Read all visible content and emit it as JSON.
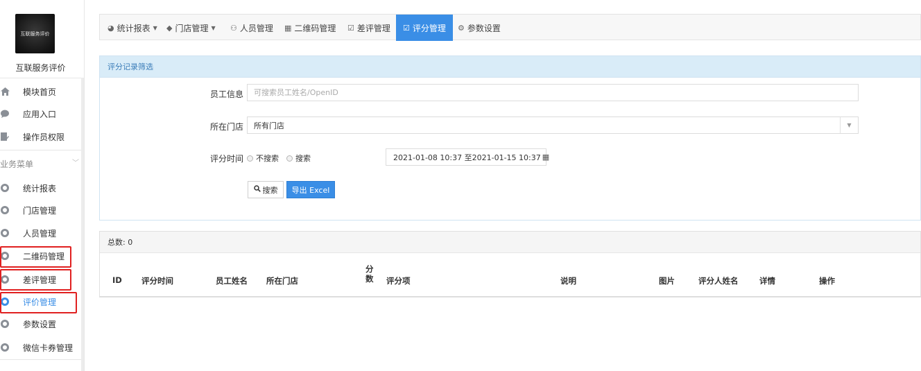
{
  "sidebar": {
    "logo_text": "互联服务评价",
    "module_name": "互联服务评价",
    "items": [
      {
        "label": "模块首页",
        "icon": "home-icon"
      },
      {
        "label": "应用入口",
        "icon": "chat-bubble-icon"
      },
      {
        "label": "操作员权限",
        "icon": "document-pen-icon"
      }
    ],
    "group_title": "业务菜单",
    "group_items": [
      {
        "label": "统计报表",
        "icon": "gear-icon"
      },
      {
        "label": "门店管理",
        "icon": "gear-icon"
      },
      {
        "label": "人员管理",
        "icon": "gear-icon"
      },
      {
        "label": "二维码管理",
        "icon": "gear-icon"
      },
      {
        "label": "差评管理",
        "icon": "gear-icon"
      },
      {
        "label": "评价管理",
        "icon": "gear-icon"
      },
      {
        "label": "参数设置",
        "icon": "gear-icon"
      },
      {
        "label": "微信卡券管理",
        "icon": "gear-icon"
      }
    ],
    "active_item": "评价管理"
  },
  "topnav": {
    "items": [
      {
        "label": "统计报表",
        "icon": "pie-chart-icon",
        "dropdown": true
      },
      {
        "label": "门店管理",
        "icon": "tag-icon",
        "dropdown": true
      },
      {
        "label": "人员管理",
        "icon": "users-icon",
        "dropdown": false
      },
      {
        "label": "二维码管理",
        "icon": "qrcode-icon",
        "dropdown": false
      },
      {
        "label": "差评管理",
        "icon": "edit-icon",
        "dropdown": false
      },
      {
        "label": "评分管理",
        "icon": "edit-icon",
        "dropdown": false
      },
      {
        "label": "参数设置",
        "icon": "cogs-icon",
        "dropdown": false
      }
    ],
    "active": "评分管理"
  },
  "filter": {
    "title": "评分记录筛选",
    "employee_label": "员工信息",
    "employee_placeholder": "可搜索员工姓名/OpenID",
    "employee_value": "",
    "store_label": "所在门店",
    "store_value": "所有门店",
    "time_label": "评分时间",
    "radio_no_search": "不搜索",
    "radio_search": "搜索",
    "date_range": "2021-01-08 10:37 至2021-01-15 10:37",
    "search_button": "搜索",
    "export_button": "导出 Excel"
  },
  "results": {
    "total_label": "总数: 0",
    "columns": [
      "ID",
      "评分时间",
      "员工姓名",
      "所在门店",
      "分数",
      "评分项",
      "说明",
      "图片",
      "评分人姓名",
      "详情",
      "操作"
    ],
    "rows": []
  },
  "colors": {
    "accent": "#3a8ee6",
    "highlight_box": "#e02020",
    "panel_header": "#d9ecf8"
  }
}
